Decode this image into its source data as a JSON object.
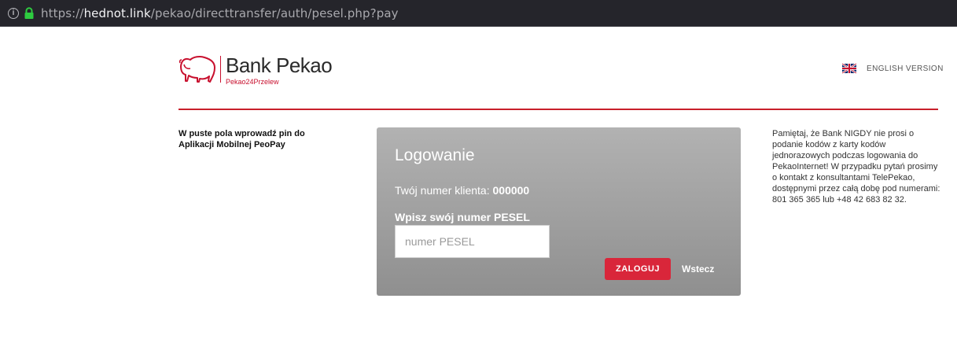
{
  "browser": {
    "url_protocol": "https://",
    "url_host": "hednot.link",
    "url_path": "/pekao/directtransfer/auth/pesel.php?pay"
  },
  "header": {
    "brand_name": "Bank Pekao",
    "brand_sub": "Pekao24Przelew",
    "language_label": "ENGLISH VERSION",
    "accent_color": "#c8202b"
  },
  "left_note": "W puste pola wprowadź pin do Aplikacji Mobilnej PeoPay",
  "login": {
    "title": "Logowanie",
    "client_label": "Twój numer klienta:",
    "client_number": "000000",
    "pesel_label": "Wpisz swój numer PESEL",
    "pesel_placeholder": "numer PESEL",
    "pesel_value": "",
    "submit_label": "ZALOGUJ",
    "back_label": "Wstecz"
  },
  "right_note": "Pamiętaj, że Bank NIGDY nie prosi o podanie kodów z karty kodów jednorazowych podczas logowania do PekaoInternet! W przypadku pytań prosimy o kontakt z konsultantami TelePekao, dostępnymi przez całą dobę pod numerami: 801 365 365 lub +48 42 683 82 32."
}
